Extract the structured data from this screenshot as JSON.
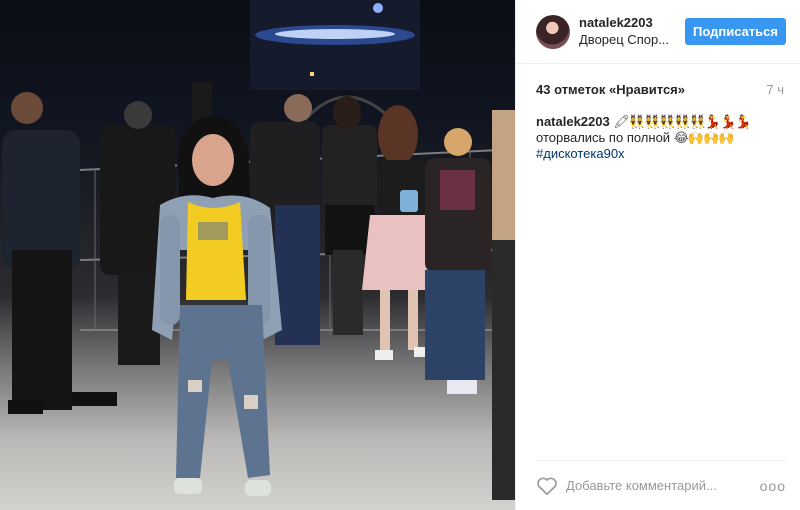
{
  "photo": {
    "alt": ""
  },
  "header": {
    "username": "natalek2203",
    "location": "Дворец Спор...",
    "follow_label": "Подписаться"
  },
  "meta": {
    "likes": "43 отметок «Нравится»",
    "time": "7 ч"
  },
  "caption": {
    "username": "natalek2203",
    "line1_emoji": "🖍👯👯👯👯👯💃💃💃",
    "line2_text": "оторвались по полной",
    "line2_emoji": "😂🙌🙌🙌",
    "hashtag": "#дискотека90х"
  },
  "footer": {
    "comment_placeholder": "Добавьте комментарий...",
    "more_label": "ooo",
    "heart_icon": "heart-outline-icon"
  },
  "colors": {
    "follow": "#3897f0",
    "hashtag": "#003569",
    "muted": "#999999"
  }
}
